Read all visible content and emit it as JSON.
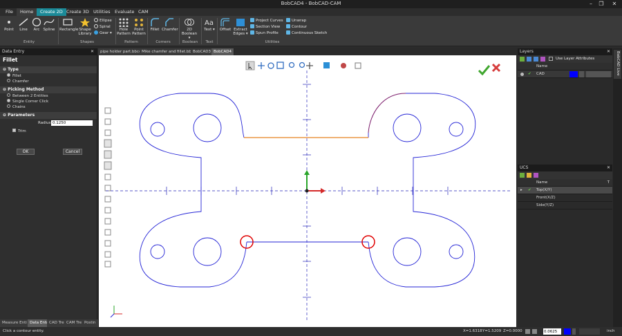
{
  "window": {
    "title": "BobCAD4 - BobCAD-CAM"
  },
  "menu": [
    "File",
    "Home",
    "Create 2D",
    "Create 3D",
    "Utilities",
    "Evaluate",
    "CAM"
  ],
  "ribbon": {
    "entity": {
      "label": "Entity",
      "items": [
        "Point",
        "Line",
        "Arc",
        "Spline"
      ]
    },
    "shapes": {
      "label": "Shapes",
      "rect": "Rectangle",
      "shape1": "Shape",
      "shape2": "Library",
      "small": [
        "Ellipse",
        "Spiral",
        "Gear"
      ]
    },
    "pattern": {
      "label": "Pattern",
      "hole1": "Hole",
      "hole2": "Pattern",
      "pt1": "Point",
      "pt2": "Pattern"
    },
    "corners": {
      "label": "Corners",
      "fillet": "Fillet",
      "chamfer": "Chamfer"
    },
    "boolean": {
      "label": "Boolean",
      "b1": "2D",
      "b2": "Boolean"
    },
    "text": {
      "label": "Text",
      "t": "Text"
    },
    "utilities": {
      "label": "Utilities",
      "offset": "Offset",
      "extract1": "Extract",
      "extract2": "Edges",
      "col1": [
        "Project Curves",
        "Section View",
        "Spun Profile"
      ],
      "col2": [
        "Unwrap",
        "Contour",
        "Continuous Sketch"
      ]
    }
  },
  "dataentry": {
    "header": "Data Entry",
    "title": "Fillet",
    "type_label": "Type",
    "type_options": [
      "Fillet",
      "Chamfer"
    ],
    "picking_label": "Picking Method",
    "picking_options": [
      "Between 2 Entities",
      "Single Corner Click",
      "Chains"
    ],
    "params_label": "Parameters",
    "radius_label": "Radius",
    "radius_value": "0.1250",
    "trim_label": "Trim",
    "ok": "OK",
    "cancel": "Cancel"
  },
  "bottomtabs": [
    "Measure Enti",
    "Data Entr",
    "CAD Tre",
    "CAM Tre",
    "Postin"
  ],
  "doctabs": [
    "pipe holder part.bbcd",
    "Mike chamfer and fillet.bbcd",
    "BobCAD3",
    "BobCAD4"
  ],
  "layers": {
    "header": "Layers",
    "use_attr": "Use Layer Attributes",
    "col_name": "Name",
    "row_name": "CAD",
    "color": "#0000ff"
  },
  "ucs": {
    "header": "UCS",
    "col_name": "Name",
    "sort": "T",
    "rows": [
      "Top(X/Y)",
      "Front(X/Z)",
      "Side(Y/Z)"
    ]
  },
  "sidebar_label": "BobCAD Live",
  "status": {
    "prompt": "Click a contour entity.",
    "x": "X=1.6318",
    "y": "Y=1.5209",
    "z": "Z=0.0000",
    "value": "0.0625",
    "units": "inch"
  },
  "colors": {
    "accent": "#1b8a98",
    "geometry": "#2323d6",
    "highlight": "#e8801e",
    "select": "#e00000"
  }
}
